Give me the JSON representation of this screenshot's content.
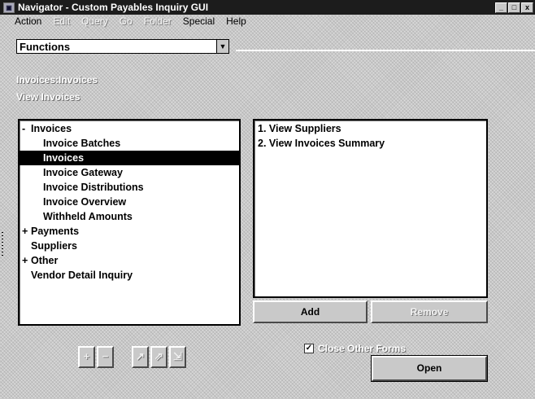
{
  "window": {
    "title": "Navigator - Custom Payables Inquiry GUI",
    "controls": [
      "_",
      "□",
      "x"
    ]
  },
  "menu": {
    "items": [
      {
        "label": "Action",
        "enabled": true
      },
      {
        "label": "Edit",
        "enabled": false
      },
      {
        "label": "Query",
        "enabled": false
      },
      {
        "label": "Go",
        "enabled": false
      },
      {
        "label": "Folder",
        "enabled": false
      },
      {
        "label": "Special",
        "enabled": true
      },
      {
        "label": "Help",
        "enabled": true
      }
    ]
  },
  "functions_select": {
    "value": "Functions",
    "arrow": "▼"
  },
  "headings": {
    "path": "Invoices:Invoices",
    "subtitle": "View Invoices"
  },
  "tree": {
    "items": [
      {
        "label": "Invoices",
        "expander": "-",
        "level": 0,
        "selected": false
      },
      {
        "label": "Invoice Batches",
        "expander": "",
        "level": 1,
        "selected": false
      },
      {
        "label": "Invoices",
        "expander": "",
        "level": 1,
        "selected": true
      },
      {
        "label": "Invoice Gateway",
        "expander": "",
        "level": 1,
        "selected": false
      },
      {
        "label": "Invoice Distributions",
        "expander": "",
        "level": 1,
        "selected": false
      },
      {
        "label": "Invoice Overview",
        "expander": "",
        "level": 1,
        "selected": false
      },
      {
        "label": "Withheld Amounts",
        "expander": "",
        "level": 1,
        "selected": false
      },
      {
        "label": "Payments",
        "expander": "+",
        "level": 0,
        "selected": false
      },
      {
        "label": "Suppliers",
        "expander": "",
        "level": 0,
        "selected": false
      },
      {
        "label": "Other",
        "expander": "+",
        "level": 0,
        "selected": false
      },
      {
        "label": "Vendor Detail Inquiry",
        "expander": "",
        "level": 0,
        "selected": false
      }
    ]
  },
  "actions_list": {
    "items": [
      "1. View Suppliers",
      "2. View Invoices Summary"
    ]
  },
  "buttons": {
    "add": "Add",
    "remove": "Remove",
    "open": "Open"
  },
  "tree_toolbar": {
    "expand": "+",
    "collapse": "−",
    "expand_branch": "↗",
    "expand_all": "⇗",
    "collapse_all": "⇲"
  },
  "close_other_forms": {
    "label": "Close Other Forms",
    "checked": true,
    "mark": "✓"
  }
}
